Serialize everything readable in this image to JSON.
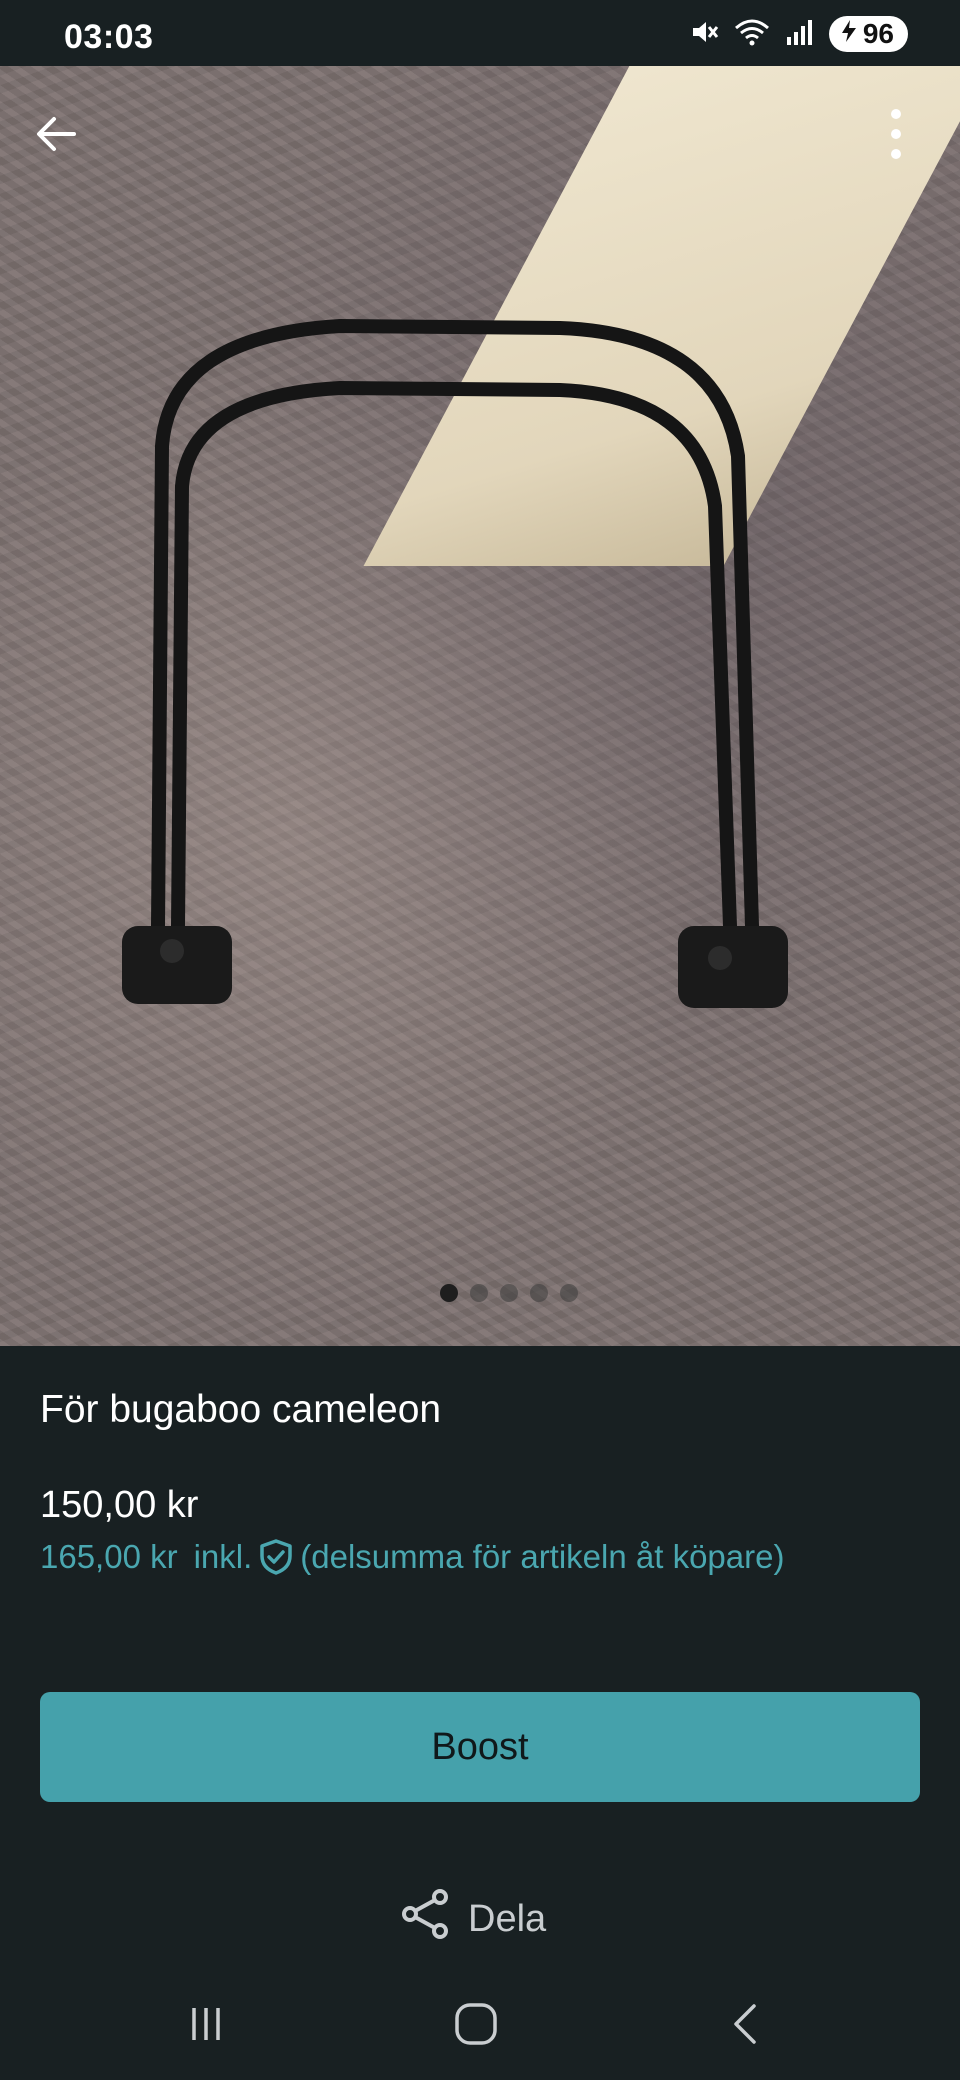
{
  "status_bar": {
    "time": "03:03",
    "battery": "96",
    "icons": [
      "mute-icon",
      "wifi-icon",
      "signal-icon",
      "battery-icon"
    ]
  },
  "hero": {
    "page_count": 5,
    "active_page": 1,
    "icons": {
      "back": "arrow-left-icon",
      "more": "more-vertical-icon"
    }
  },
  "listing": {
    "title": "För bugaboo cameleon",
    "price": "150,00 kr",
    "price_incl_amount": "165,00 kr",
    "price_incl_word": "inkl.",
    "price_incl_note": "(delsumma för artikeln åt köpare)"
  },
  "actions": {
    "boost_label": "Boost",
    "share_label": "Dela"
  },
  "colors": {
    "background": "#182022",
    "accent": "#45a1ab",
    "accent_text": "#4aa7b0"
  }
}
